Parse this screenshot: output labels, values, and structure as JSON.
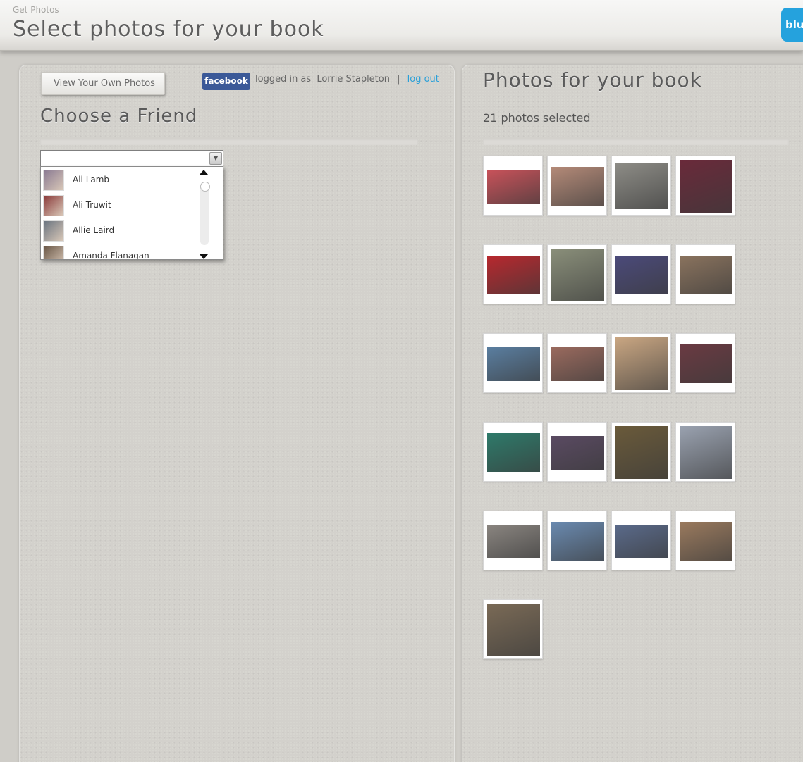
{
  "header": {
    "breadcrumb": "Get Photos",
    "title": "Select photos for your book",
    "brand": "blu"
  },
  "left": {
    "view_own_label": "View Your Own Photos",
    "facebook_label": "facebook",
    "logged_in_label": "logged in as",
    "user_name": "Lorrie Stapleton",
    "separator": "|",
    "logout_label": "log out",
    "choose_title": "Choose a Friend",
    "select_value": "",
    "friends": [
      {
        "name": "Ali Lamb",
        "color": "#8a7a92"
      },
      {
        "name": "Ali Truwit",
        "color": "#8a3a3a"
      },
      {
        "name": "Allie Laird",
        "color": "#6a7480"
      },
      {
        "name": "Amanda Flanagan",
        "color": "#6b5848"
      }
    ]
  },
  "right": {
    "title": "Photos for your book",
    "count_label": "21 photos selected",
    "photos": [
      {
        "color": "#c9525a",
        "h": 48
      },
      {
        "color": "#b48a78",
        "h": 55
      },
      {
        "color": "#8d8c86",
        "h": 65
      },
      {
        "color": "#6a2a3a",
        "h": 75
      },
      {
        "color": "#b8282e",
        "h": 55
      },
      {
        "color": "#8a8f7a",
        "h": 75
      },
      {
        "color": "#4b4a7a",
        "h": 55
      },
      {
        "color": "#8a735e",
        "h": 55
      },
      {
        "color": "#5a7ea0",
        "h": 48
      },
      {
        "color": "#9a6a5e",
        "h": 48
      },
      {
        "color": "#c9a682",
        "h": 75
      },
      {
        "color": "#6a3a42",
        "h": 55
      },
      {
        "color": "#2e7a6a",
        "h": 55
      },
      {
        "color": "#5a4a62",
        "h": 48
      },
      {
        "color": "#6a5a3a",
        "h": 75
      },
      {
        "color": "#9aa2b0",
        "h": 75
      },
      {
        "color": "#8a8580",
        "h": 48
      },
      {
        "color": "#6a8ab0",
        "h": 55
      },
      {
        "color": "#5a6a8a",
        "h": 48
      },
      {
        "color": "#9a7a5e",
        "h": 55
      },
      {
        "color": "#7a6a56",
        "h": 75
      }
    ]
  }
}
